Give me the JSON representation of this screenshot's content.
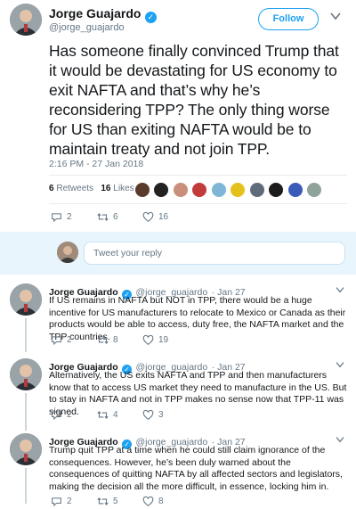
{
  "tweet": {
    "author_name": "Jorge Guajardo",
    "author_handle": "@jorge_guajardo",
    "follow_label": "Follow",
    "text": "Has someone finally convinced Trump that it would be devastating for US economy to exit NAFTA and that’s why he’s reconsidering TPP? The only thing worse for US than exiting NAFTA would be to maintain treaty and not join TPP.",
    "timestamp": "2:16 PM - 27 Jan 2018",
    "retweets_count": "6",
    "retweets_label": "Retweets",
    "likes_count": "16",
    "likes_label": "Likes",
    "actions": {
      "replies": "2",
      "retweets": "6",
      "likes": "16"
    }
  },
  "reply_composer": {
    "placeholder": "Tweet your reply"
  },
  "replies": [
    {
      "author_name": "Jorge Guajardo",
      "author_handle": "@jorge_guajardo",
      "date": "· Jan 27",
      "text": "If US remains in NAFTA but NOT in TPP, there would be a huge incentive for US manufacturers to relocate to Mexico or Canada as their products would be able to access, duty free, the NAFTA market and the TPP countries.",
      "replies": "2",
      "retweets": "8",
      "likes": "19"
    },
    {
      "author_name": "Jorge Guajardo",
      "author_handle": "@jorge_guajardo",
      "date": "· Jan 27",
      "text": "Alternatively, the US exits NAFTA and TPP and then manufacturers know that to access US market they need to manufacture in the US. But to stay in NAFTA and not in TPP makes no sense now that TPP-11 was signed.",
      "replies": "2",
      "retweets": "4",
      "likes": "3"
    },
    {
      "author_name": "Jorge Guajardo",
      "author_handle": "@jorge_guajardo",
      "date": "· Jan 27",
      "text": "Trump quit TPP at a time when he could still claim ignorance of the consequences. However, he’s been duly warned about the consequences of quitting NAFTA by all affected sectors and legislators, making the decision all the more difficult, in essence, locking him in.",
      "replies": "2",
      "retweets": "5",
      "likes": "8"
    }
  ],
  "colors": {
    "accent": "#1da1f2",
    "secondary_text": "#657786",
    "divider": "#e6ecf0"
  }
}
